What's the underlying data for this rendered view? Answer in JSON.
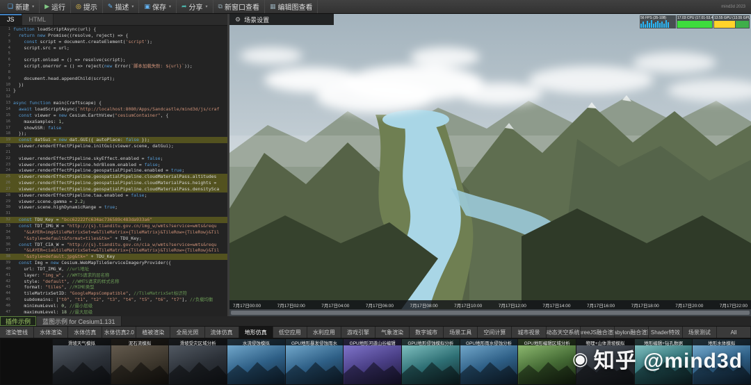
{
  "toolbar": {
    "items": [
      {
        "id": "new",
        "label": "新建",
        "dropdown": true
      },
      {
        "id": "run",
        "label": "运行",
        "dropdown": false
      },
      {
        "id": "hint",
        "label": "提示",
        "dropdown": false
      },
      {
        "id": "describe",
        "label": "描述",
        "dropdown": true
      },
      {
        "id": "save",
        "label": "保存",
        "dropdown": true
      },
      {
        "id": "share",
        "label": "分享",
        "dropdown": true
      },
      {
        "id": "new-window",
        "label": "新窗口查看",
        "dropdown": false
      },
      {
        "id": "edit-view",
        "label": "编辑图查看",
        "dropdown": false
      }
    ],
    "corner_badge": "mind3d 2023"
  },
  "editor": {
    "tabs": [
      {
        "id": "js",
        "label": "JS",
        "active": true
      },
      {
        "id": "html",
        "label": "HTML",
        "active": false
      }
    ],
    "highlighted_lines": [
      19,
      25,
      26,
      27,
      32,
      38
    ],
    "lines": [
      "function loadScriptAsync(url) {",
      "  return new Promise((resolve, reject) => {",
      "    const script = document.createElement('script');",
      "    script.src = url;",
      "",
      "    script.onload = () => resolve(script);",
      "    script.onerror = () => reject(new Error(`脚本加载失败: ${url}`));",
      "",
      "    document.head.appendChild(script);",
      "  })",
      "}",
      "",
      "async function main(Craftscape) {",
      "  await loadScriptAsync(`http://localhost:8080/Apps/Sandcastle/mind3d/js/craf",
      "  const viewer = new Cesium.EarthView(\"cesiumContainer\", {",
      "    maxaSamples: 1,",
      "    showSSR: false",
      "  });",
      "  const datGui = new dat.GUI({ autoPlace: false });",
      "  viewer.renderEffectPipeline.initGui(viewer.scene, datGui);",
      "",
      "  viewer.renderEffectPipeline.skyEffect.enabled = false;",
      "  viewer.renderEffectPipeline.hdrBloom.enabled = false;",
      "  viewer.renderEffectPipeline.geospatialPipeline.enabled = true;",
      "  viewer.renderEffectPipeline.geospatialPipeline.cloudMaterialPass.altitudes",
      "  viewer.renderEffectPipeline.geospatialPipeline.cloudMaterialPass.heights =",
      "  viewer.renderEffectPipeline.geospatialPipeline.cloudMaterialPass.densitySca",
      "  viewer.renderEffectPipeline.taa.enabled = false;",
      "  viewer.scene.gamma = 2.2;",
      "  viewer.scene.highDynamicRange = true;",
      "",
      "  const TDU_Key = \"bcc62222fc634ac736589c483da933a6\"",
      "  const TDT_IMG_W = \"http://{s}.tianditu.gov.cn/img_w/wmts?service=wmts&requ",
      "    \"&LAYER=img&tileMatrixSet=w&TileMatrix={TileMatrix}&TileRow={TileRow}&Til",
      "    \"&style=default&format=tiles&tk=\" + TDU_Key;",
      "  const TDT_CIA_W = \"http://{s}.tianditu.gov.cn/cia_w/wmts?service=wmts&requ",
      "    \"&LAYER=cia&tileMatrixSet=w&TileMatrix={TileMatrix}&TileRow={TileRow}&Til",
      "    \"&style=default.jpg&tk=\" + TDU_Key",
      "  const Img = new Cesium.WebMapTileServiceImageryProvider({",
      "    url: TDT_IMG_W, //url地址",
      "    layer: \"img_w\", //WMTS请求的层名称",
      "    style: \"default\", //WMTS请求的样式名称",
      "    format: \"tiles\", //MIME类型",
      "    tileMatrixSetID: \"GoogleMapsCompatible\", //TileMatrixSet标识符",
      "    subdomains: [\"t0\", \"t1\", \"t2\", \"t3\", \"t4\", \"t5\", \"t6\", \"t7\"], //负载均衡",
      "    minimumLevel: 0, //最小层级",
      "    maximumLevel: 18 //最大层级"
    ]
  },
  "viewport": {
    "scene_settings_label": "场景设置",
    "perf": [
      {
        "id": "fps",
        "label": "56 FPS (35-108)",
        "color": "#29b6f6",
        "pattern": "bars"
      },
      {
        "id": "cpu",
        "label": "17.03 CPU (17.01-53.48)",
        "color": "#3ddc3d",
        "pattern": "solid"
      },
      {
        "id": "gpu",
        "label": "13.55 GPU (13.55 GPU)",
        "color": "#ffd32a",
        "pattern": "blocks"
      }
    ],
    "timeline": [
      "7月17日00:00",
      "7月17日02:00",
      "7月17日04:00",
      "7月17日06:00",
      "7月17日08:00",
      "7月17日10:00",
      "7月17日12:00",
      "7月17日14:00",
      "7月17日16:00",
      "7月17日18:00",
      "7月17日20:00",
      "7月17日22:00"
    ]
  },
  "bottom": {
    "panel_tabs": [
      {
        "label": "插件示例",
        "active": true
      },
      {
        "label": "蓝图示例 for Cesium1.131",
        "active": false
      }
    ],
    "category_tabs": [
      {
        "label": "渲染管线",
        "active": false
      },
      {
        "label": "水体渲染",
        "active": false
      },
      {
        "label": "水体仿真",
        "active": false
      },
      {
        "label": "水体仿真2.0",
        "active": false
      },
      {
        "label": "植被渲染",
        "active": false
      },
      {
        "label": "全局光照",
        "active": false
      },
      {
        "label": "流体仿真",
        "active": false
      },
      {
        "label": "地形仿真",
        "active": true
      },
      {
        "label": "低空应用",
        "active": false
      },
      {
        "label": "水利应用",
        "active": false
      },
      {
        "label": "游戏引擎",
        "active": false
      },
      {
        "label": "气象渲染",
        "active": false
      },
      {
        "label": "数字城市",
        "active": false
      },
      {
        "label": "场景工具",
        "active": false
      },
      {
        "label": "空间计算",
        "active": false
      },
      {
        "label": "城市视景",
        "active": false
      },
      {
        "label": "动态天空系统",
        "active": false
      },
      {
        "label": "ThreeJS融合渲染",
        "active": false
      },
      {
        "label": "Babylon融合渲染",
        "active": false
      },
      {
        "label": "Shader特效",
        "active": false
      },
      {
        "label": "场景测试",
        "active": false
      },
      {
        "label": "All",
        "active": false
      }
    ],
    "thumbnails": [
      {
        "label": "滑坡天气模拟",
        "tone": "dark"
      },
      {
        "label": "泥石流模拟",
        "tone": "sand"
      },
      {
        "label": "滑坡受灾区域分析",
        "tone": "dark"
      },
      {
        "label": "水流侵蚀模拟",
        "tone": "blue"
      },
      {
        "label": "GPU地形暴发侵蚀雨水",
        "tone": "blue"
      },
      {
        "label": "GPU地形河道山谷编辑",
        "tone": "purple"
      },
      {
        "label": "GPU地形侵蚀模拟分析",
        "tone": "teal"
      },
      {
        "label": "GPU地形雨水侵蚀分析",
        "tone": "blue"
      },
      {
        "label": "GPU地形编辑区域分析",
        "tone": "green"
      },
      {
        "label": "物理+山体滑坡模拟",
        "tone": "dark"
      },
      {
        "label": "地形编辑+钻孔数据",
        "tone": "teal"
      },
      {
        "label": "地形水体模拟",
        "tone": "blue"
      }
    ]
  },
  "watermark": "知乎 @mind3d"
}
